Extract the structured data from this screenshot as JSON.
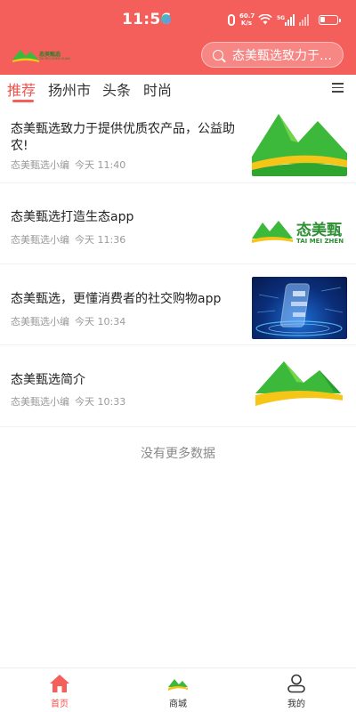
{
  "status_bar": {
    "time": "11:56",
    "net_speed_value": "60.7",
    "net_speed_unit": "K/s",
    "network_type": "5G"
  },
  "header": {
    "logo_text": "态美甄选",
    "logo_subtext": "TAI MEI ZHEN XUAN",
    "search_text": "态美甄选致力于提供优质农产品"
  },
  "tabs": [
    {
      "label": "推荐",
      "active": true
    },
    {
      "label": "扬州市",
      "active": false
    },
    {
      "label": "头条",
      "active": false
    },
    {
      "label": "时尚",
      "active": false
    }
  ],
  "news": [
    {
      "title": "态美甄选致力于提供优质农产品，公益助农!",
      "author": "态美甄选小编",
      "time": "今天 11:40",
      "thumb": "mountain-logo-crop"
    },
    {
      "title": "态美甄选打造生态app",
      "author": "态美甄选小编",
      "time": "今天 11:36",
      "thumb": "logo-with-text",
      "thumb_brand": "态美甄",
      "thumb_brand_sub": "TAI MEI ZHEN"
    },
    {
      "title": "态美甄选，更懂消费者的社交购物app",
      "author": "态美甄选小编",
      "time": "今天 10:34",
      "thumb": "blue-phone"
    },
    {
      "title": "态美甄选简介",
      "author": "态美甄选小编",
      "time": "今天 10:33",
      "thumb": "mountain-logo"
    }
  ],
  "list_footer": "没有更多数据",
  "bottom_nav": [
    {
      "label": "首页",
      "icon": "home-icon",
      "active": true
    },
    {
      "label": "商城",
      "icon": "store-logo-icon",
      "active": false
    },
    {
      "label": "我的",
      "icon": "user-icon",
      "active": false
    }
  ],
  "colors": {
    "brand_red": "#f45f5c",
    "active_text": "#f0524e",
    "mountain_green": "#3cb83a",
    "mountain_yellow": "#f5c518"
  }
}
